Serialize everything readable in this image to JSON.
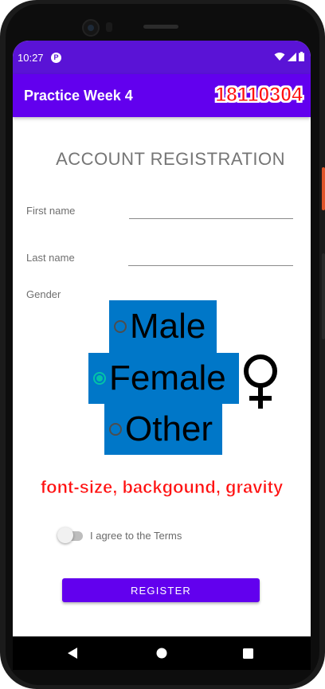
{
  "status_bar": {
    "time": "10:27",
    "app_icon_glyph": "P",
    "icons": [
      "wifi-icon",
      "signal-icon",
      "battery-icon"
    ]
  },
  "app_bar": {
    "title": "Practice Week 4",
    "student_id": "18110304"
  },
  "form": {
    "title": "ACCOUNT REGISTRATION",
    "first_name": {
      "label": "First name",
      "value": ""
    },
    "last_name": {
      "label": "Last name",
      "value": ""
    },
    "gender": {
      "label": "Gender",
      "options": [
        {
          "label": "Male",
          "checked": false
        },
        {
          "label": "Female",
          "checked": true
        },
        {
          "label": "Other",
          "checked": false
        }
      ]
    },
    "annotation": "font-size, backgound, gravity",
    "terms": {
      "label": "I agree to the Terms",
      "on": false
    },
    "register_label": "REGISTER"
  },
  "nav_bar": {
    "icons": [
      "back-icon",
      "home-icon",
      "recents-icon"
    ]
  },
  "colors": {
    "status_bar": "#5a13d6",
    "app_bar": "#6200ee",
    "radio_highlight": "#0077c8",
    "radio_checked": "#03c2a8",
    "annotation_red": "#ff1010",
    "button": "#6200ee"
  }
}
